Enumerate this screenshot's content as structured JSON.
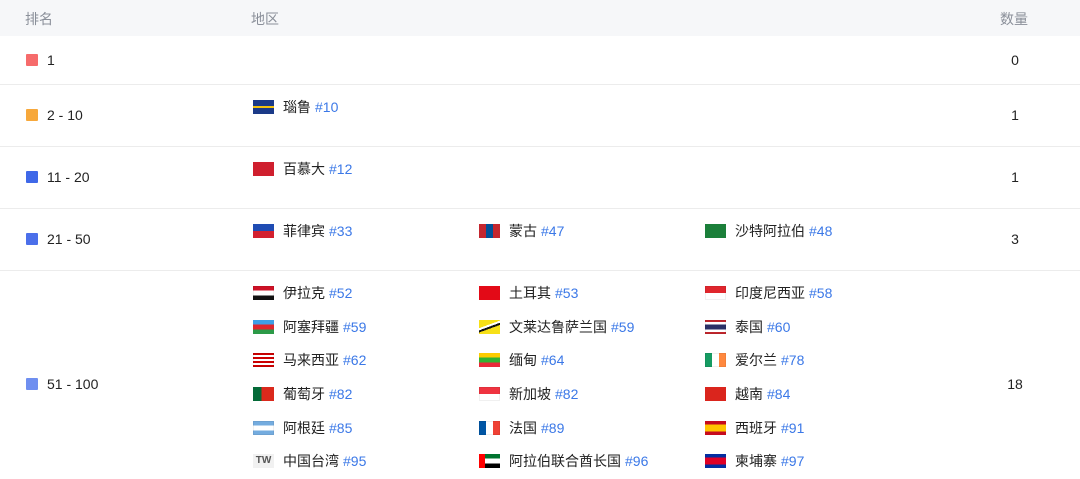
{
  "header": {
    "rank": "排名",
    "region": "地区",
    "count": "数量"
  },
  "rows": [
    {
      "rank": "1",
      "color": "#f66b6b",
      "count": "0",
      "items": []
    },
    {
      "rank": "2 - 10",
      "color": "#f7a83b",
      "count": "1",
      "items": [
        {
          "name": "瑙鲁",
          "rank": "#10",
          "flag": "nauru"
        }
      ]
    },
    {
      "rank": "11 - 20",
      "color": "#3f68e8",
      "count": "1",
      "items": [
        {
          "name": "百慕大",
          "rank": "#12",
          "flag": "bermuda"
        }
      ]
    },
    {
      "rank": "21 - 50",
      "color": "#4b6fea",
      "count": "3",
      "items": [
        {
          "name": "菲律宾",
          "rank": "#33",
          "flag": "philippines"
        },
        {
          "name": "蒙古",
          "rank": "#47",
          "flag": "mongolia"
        },
        {
          "name": "沙特阿拉伯",
          "rank": "#48",
          "flag": "saudi"
        }
      ]
    },
    {
      "rank": "51 - 100",
      "color": "#6f8ff0",
      "count": "18",
      "items": [
        {
          "name": "伊拉克",
          "rank": "#52",
          "flag": "iraq"
        },
        {
          "name": "土耳其",
          "rank": "#53",
          "flag": "turkey"
        },
        {
          "name": "印度尼西亚",
          "rank": "#58",
          "flag": "indonesia"
        },
        {
          "name": "阿塞拜疆",
          "rank": "#59",
          "flag": "azerbaijan"
        },
        {
          "name": "文莱达鲁萨兰国",
          "rank": "#59",
          "flag": "brunei"
        },
        {
          "name": "泰国",
          "rank": "#60",
          "flag": "thailand"
        },
        {
          "name": "马来西亚",
          "rank": "#62",
          "flag": "malaysia"
        },
        {
          "name": "缅甸",
          "rank": "#64",
          "flag": "myanmar"
        },
        {
          "name": "爱尔兰",
          "rank": "#78",
          "flag": "ireland"
        },
        {
          "name": "葡萄牙",
          "rank": "#82",
          "flag": "portugal"
        },
        {
          "name": "新加坡",
          "rank": "#82",
          "flag": "singapore"
        },
        {
          "name": "越南",
          "rank": "#84",
          "flag": "vietnam"
        },
        {
          "name": "阿根廷",
          "rank": "#85",
          "flag": "argentina"
        },
        {
          "name": "法国",
          "rank": "#89",
          "flag": "france"
        },
        {
          "name": "西班牙",
          "rank": "#91",
          "flag": "spain"
        },
        {
          "name": "中国台湾",
          "rank": "#95",
          "flag": "tw",
          "badge": "TW"
        },
        {
          "name": "阿拉伯联合酋长国",
          "rank": "#96",
          "flag": "uae"
        },
        {
          "name": "柬埔寨",
          "rank": "#97",
          "flag": "cambodia"
        }
      ]
    }
  ]
}
